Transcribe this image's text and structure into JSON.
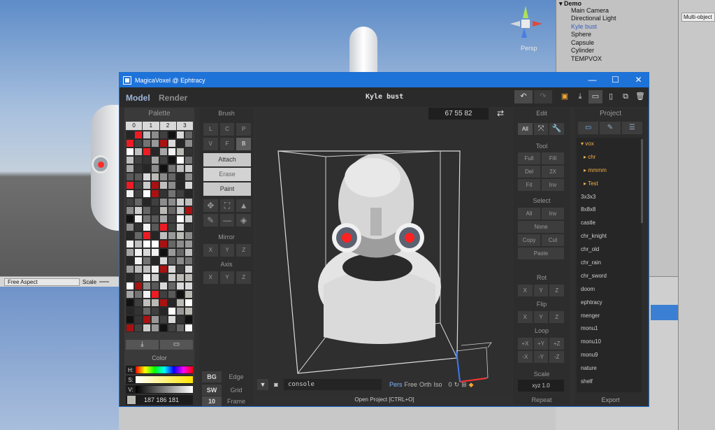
{
  "unity": {
    "hierarchy_root": "Demo",
    "hierarchy_items": [
      "Main Camera",
      "Directional Light",
      "Kyle bust",
      "Sphere",
      "Capsule",
      "Cylinder",
      "TEMPVOX"
    ],
    "selected_item": "Kyle bust",
    "inspector_field": "Multi-object",
    "scene_persp_label": "Persp",
    "game_aspect": "Free Aspect",
    "game_scale_label": "Scale"
  },
  "magicavoxel": {
    "window_title": "MagicaVoxel @ Ephtracy",
    "tabs": {
      "model": "Model",
      "render": "Render"
    },
    "document_title": "Kyle bust",
    "palette": {
      "header": "Palette",
      "tabs": [
        "0",
        "1",
        "2",
        "3"
      ],
      "color_label": "Color",
      "sliders": [
        "H:",
        "S:",
        "V:"
      ],
      "rgb_value": "187 186 181",
      "colors": [
        "#f2f2f2",
        "#d9d9d9",
        "#bfbfbf",
        "#a6a6a6",
        "#8c8c8c",
        "#737373",
        "#595959",
        "#404040",
        "#262626",
        "#111111",
        "#ed1c24",
        "#aa1111",
        "#ffffff",
        "#cccccc",
        "#999999",
        "#666666",
        "#bbbab5",
        "#333333"
      ]
    },
    "brush": {
      "header": "Brush",
      "shapes": [
        "L",
        "C",
        "P",
        "V",
        "F",
        "B"
      ],
      "modes": [
        "Attach",
        "Erase",
        "Paint"
      ],
      "tools": [
        "move-icon",
        "select-icon",
        "pick-icon",
        "pen-icon",
        "line-icon",
        "fill-icon"
      ],
      "mirror_label": "Mirror",
      "axis_label": "Axis",
      "xyz": [
        "X",
        "Y",
        "Z"
      ],
      "footer": [
        {
          "key": "BG",
          "label": "Edge"
        },
        {
          "key": "SW",
          "label": "Grid"
        },
        {
          "key": "10",
          "label": "Frame"
        }
      ]
    },
    "viewport": {
      "coords": "67 55 82",
      "console_text": "console",
      "view_modes": [
        "Pers",
        "Free",
        "Orth",
        "Iso"
      ],
      "active_view": "Pers",
      "zero": "0",
      "status_text": "Open Project [CTRL+O]"
    },
    "edit": {
      "header": "Edit",
      "all_label": "All",
      "tool_label": "Tool",
      "tool_buttons": [
        "Full",
        "Fill",
        "Del",
        "2X",
        "Fit",
        "Inv"
      ],
      "select_label": "Select",
      "select_buttons": [
        "All",
        "Inv"
      ],
      "none_label": "None",
      "copy_label": "Copy",
      "cut_label": "Cut",
      "paste_label": "Paste",
      "rot_label": "Rot",
      "flip_label": "Flip",
      "loop_label": "Loop",
      "loop_buttons": [
        "+X",
        "+Y",
        "+Z",
        "-X",
        "-Y",
        "-Z"
      ],
      "scale_label": "Scale",
      "scale_value": "xyz 1.0",
      "repeat_label": "Repeat"
    },
    "project": {
      "header": "Project",
      "root_folder": "▾ vox",
      "subfolders": [
        "▸ chr",
        "▸ mmmm",
        "▸ Test"
      ],
      "files": [
        "3x3x3",
        "8x8x8",
        "castle",
        "chr_knight",
        "chr_old",
        "chr_rain",
        "chr_sword",
        "doom",
        "ephtracy",
        "menger",
        "monu1",
        "monu10",
        "monu9",
        "nature",
        "shelf"
      ],
      "export_label": "Export"
    }
  }
}
